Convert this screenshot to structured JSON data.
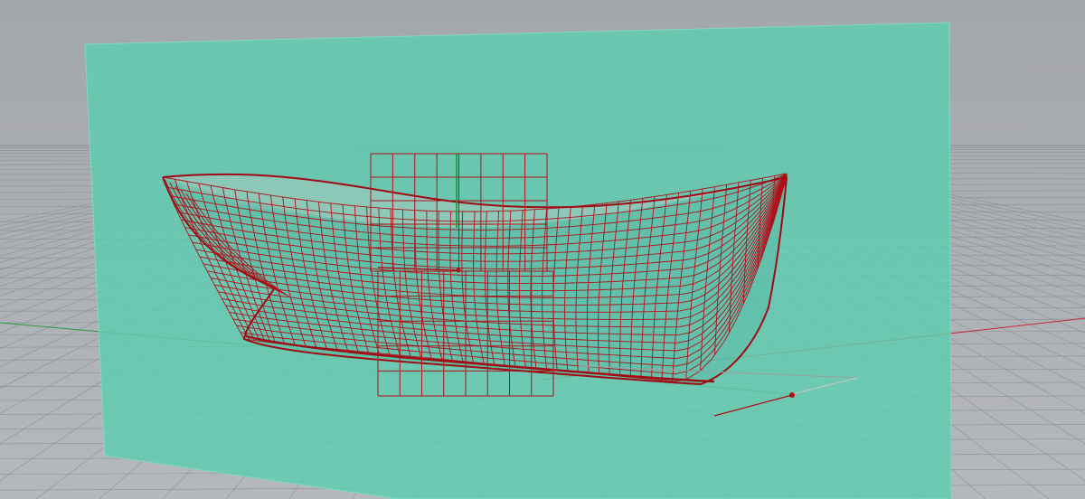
{
  "viewport": {
    "view": "Perspective",
    "colors": {
      "background_top": "#a3a6ab",
      "background_bottom": "#b8bbbf",
      "grid_line": "#8f9297",
      "grid_major": "#858890",
      "plane_fill": "#5ecdb1",
      "hull_wire": "#b0101a",
      "x_axis": "#c8292e",
      "y_axis": "#2a9a3a",
      "z_axis": "#1a9a2a",
      "gumball_grid": "#b0101a"
    }
  },
  "objects": [
    {
      "name": "hull-surface",
      "type": "NURBS surface (control net shown)"
    },
    {
      "name": "section-plane",
      "type": "Plane"
    },
    {
      "name": "cplane-grid",
      "type": "Construction grid"
    }
  ]
}
